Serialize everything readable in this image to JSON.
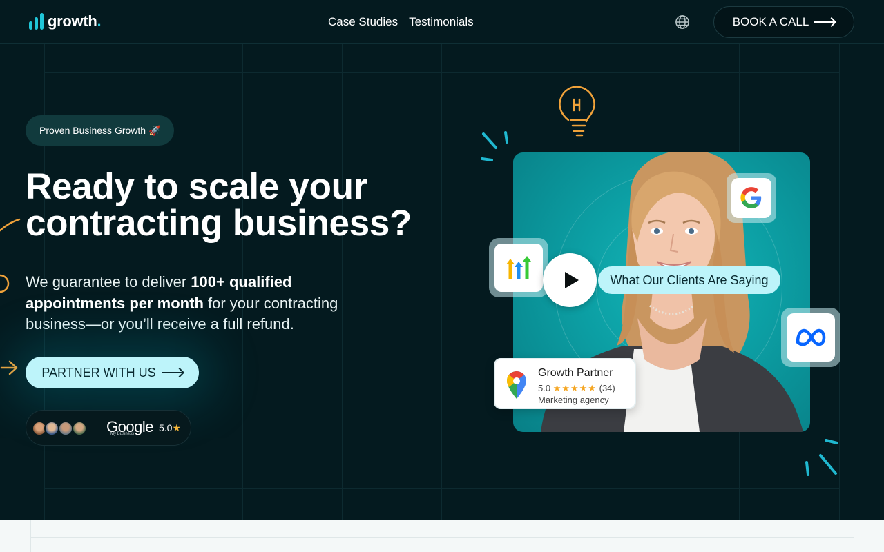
{
  "header": {
    "logo_text": "growth",
    "logo_dot": ".",
    "nav": [
      {
        "label": "Case Studies"
      },
      {
        "label": "Testimonials"
      }
    ],
    "language_icon": "globe-icon",
    "cta_label": "BOOK A CALL"
  },
  "hero": {
    "badge": "Proven Business Growth 🚀",
    "title_line1": "Ready to scale your",
    "title_line2": "contracting business?",
    "sub_part1": "We guarantee to deliver ",
    "sub_bold": "100+ qualified appointments per month",
    "sub_part2": " for your contracting business—or you’ll receive a full refund.",
    "cta_label": "PARTNER WITH US",
    "reviews": {
      "google_word": "Google",
      "google_sub": "My Business",
      "rating": "5.0",
      "star": "★"
    }
  },
  "video": {
    "clients_label": "What Our Clients Are Saying",
    "play_icon": "play-icon",
    "card": {
      "title": "Growth Partner",
      "rating": "5.0",
      "stars": "★★★★★",
      "count": "(34)",
      "type": "Marketing agency"
    },
    "tiles": [
      "google-logo-icon",
      "highlevel-logo-icon",
      "meta-logo-icon"
    ]
  },
  "colors": {
    "background": "#041a1f",
    "accent": "#20c6d8",
    "button_light": "#bdf4fa",
    "deco_orange": "#f0a23a"
  }
}
